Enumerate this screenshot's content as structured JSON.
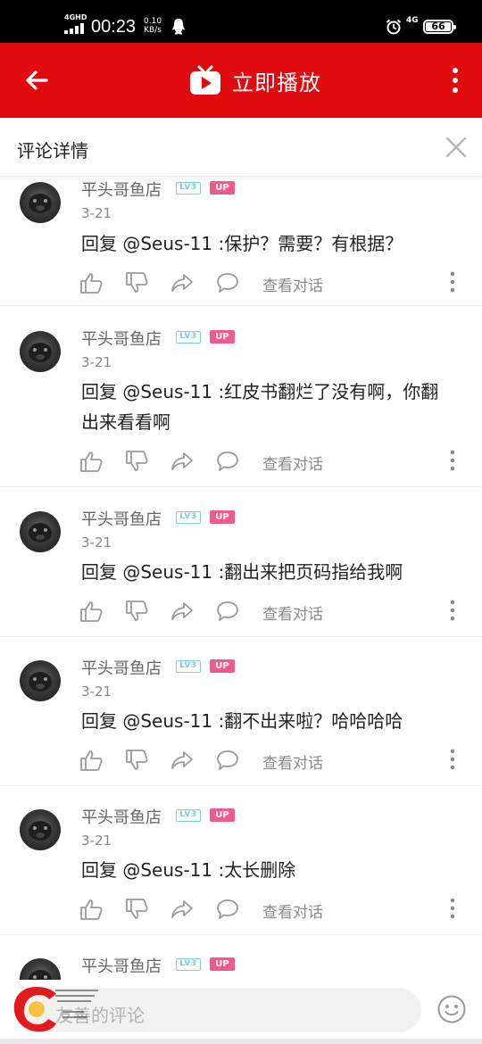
{
  "status_bar": {
    "network_label": "4GHD",
    "time": "00:23",
    "speed_value": "0.10",
    "speed_unit": "KB/s",
    "network_right": "4G",
    "battery": "66"
  },
  "header": {
    "title": "立即播放",
    "accent_color": "#e00b0f"
  },
  "detail": {
    "title": "评论详情"
  },
  "comments": [
    {
      "user": "平头哥鱼店",
      "level": "LV3",
      "badge": "UP",
      "date": "3-21",
      "text": "回复 @Seus-11 :保护？需要？有根据？",
      "view_talk": "查看对话"
    },
    {
      "user": "平头哥鱼店",
      "level": "LV3",
      "badge": "UP",
      "date": "3-21",
      "text": "回复 @Seus-11 :红皮书翻烂了没有啊，你翻出来看看啊",
      "view_talk": "查看对话"
    },
    {
      "user": "平头哥鱼店",
      "level": "LV3",
      "badge": "UP",
      "date": "3-21",
      "text": "回复 @Seus-11 :翻出来把页码指给我啊",
      "view_talk": "查看对话"
    },
    {
      "user": "平头哥鱼店",
      "level": "LV3",
      "badge": "UP",
      "date": "3-21",
      "text": "回复 @Seus-11 :翻不出来啦？哈哈哈哈",
      "view_talk": "查看对话"
    },
    {
      "user": "平头哥鱼店",
      "level": "LV3",
      "badge": "UP",
      "date": "3-21",
      "text": "回复 @Seus-11 :太长删除",
      "view_talk": "查看对话"
    },
    {
      "user": "平头哥鱼店",
      "level": "LV3",
      "badge": "UP"
    }
  ],
  "bottom": {
    "placeholder": "友善的评论"
  },
  "icons": {
    "back": "arrow-left-icon",
    "tv": "tv-play-icon",
    "more": "more-vertical-icon",
    "close": "close-icon",
    "like": "thumb-up-icon",
    "dislike": "thumb-down-icon",
    "share": "share-icon",
    "comment": "comment-bubble-icon",
    "emoji": "emoji-icon"
  }
}
